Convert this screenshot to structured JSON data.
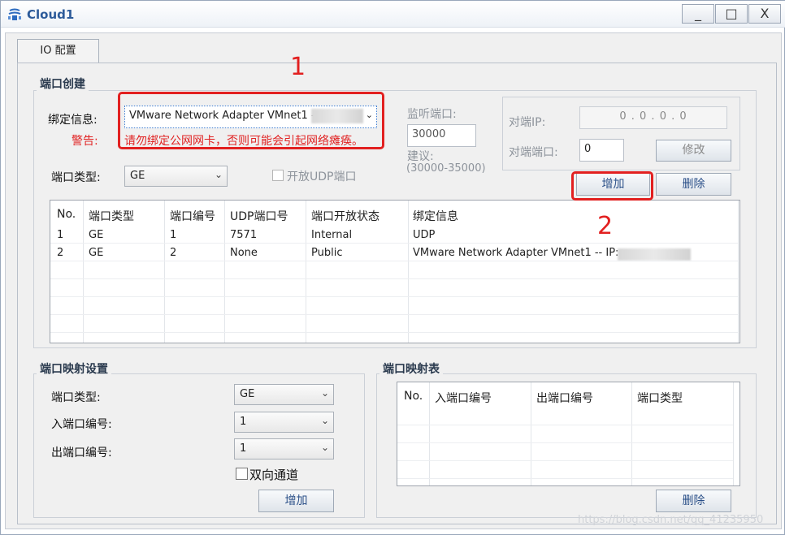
{
  "window": {
    "title": "Cloud1",
    "controls": {
      "minimize": "_",
      "maximize": "□",
      "close": "X"
    }
  },
  "tab": {
    "label": "IO 配置"
  },
  "port_create": {
    "title": "端口创建",
    "bind_label": "绑定信息:",
    "bind_value": "VMware Network Adapter VMnet1 -- IP:",
    "warning_label": "警告:",
    "warning_text": "请勿绑定公网网卡，否则可能会引起网络瘫痪。",
    "port_type_label": "端口类型:",
    "port_type_value": "GE",
    "udp_checkbox_label": "开放UDP端口",
    "listen_port_label": "监听端口:",
    "listen_port_value": "30000",
    "suggest_label": "建议:",
    "suggest_range": "(30000-35000)",
    "peer_ip_label": "对端IP:",
    "peer_ip_value": "0  .  0  .  0  .  0",
    "peer_port_label": "对端端口:",
    "peer_port_value": "0",
    "modify_button": "修改",
    "add_button": "增加",
    "delete_button": "删除"
  },
  "port_table": {
    "headers": [
      "No.",
      "端口类型",
      "端口编号",
      "UDP端口号",
      "端口开放状态",
      "绑定信息"
    ],
    "rows": [
      [
        "1",
        "GE",
        "1",
        "7571",
        "Internal",
        "UDP"
      ],
      [
        "2",
        "GE",
        "2",
        "None",
        "Public",
        "VMware Network Adapter VMnet1 -- IP:"
      ]
    ]
  },
  "port_mapping_settings": {
    "title": "端口映射设置",
    "port_type_label": "端口类型:",
    "port_type_value": "GE",
    "in_port_label": "入端口编号:",
    "in_port_value": "1",
    "out_port_label": "出端口编号:",
    "out_port_value": "1",
    "bidirectional_label": "双向通道",
    "add_button": "增加"
  },
  "port_mapping_table": {
    "title": "端口映射表",
    "headers": [
      "No.",
      "入端口编号",
      "出端口编号",
      "端口类型"
    ],
    "delete_button": "删除"
  },
  "annotations": {
    "first": "1",
    "second": "2"
  },
  "watermark": "https://blog.csdn.net/qq_41235950"
}
